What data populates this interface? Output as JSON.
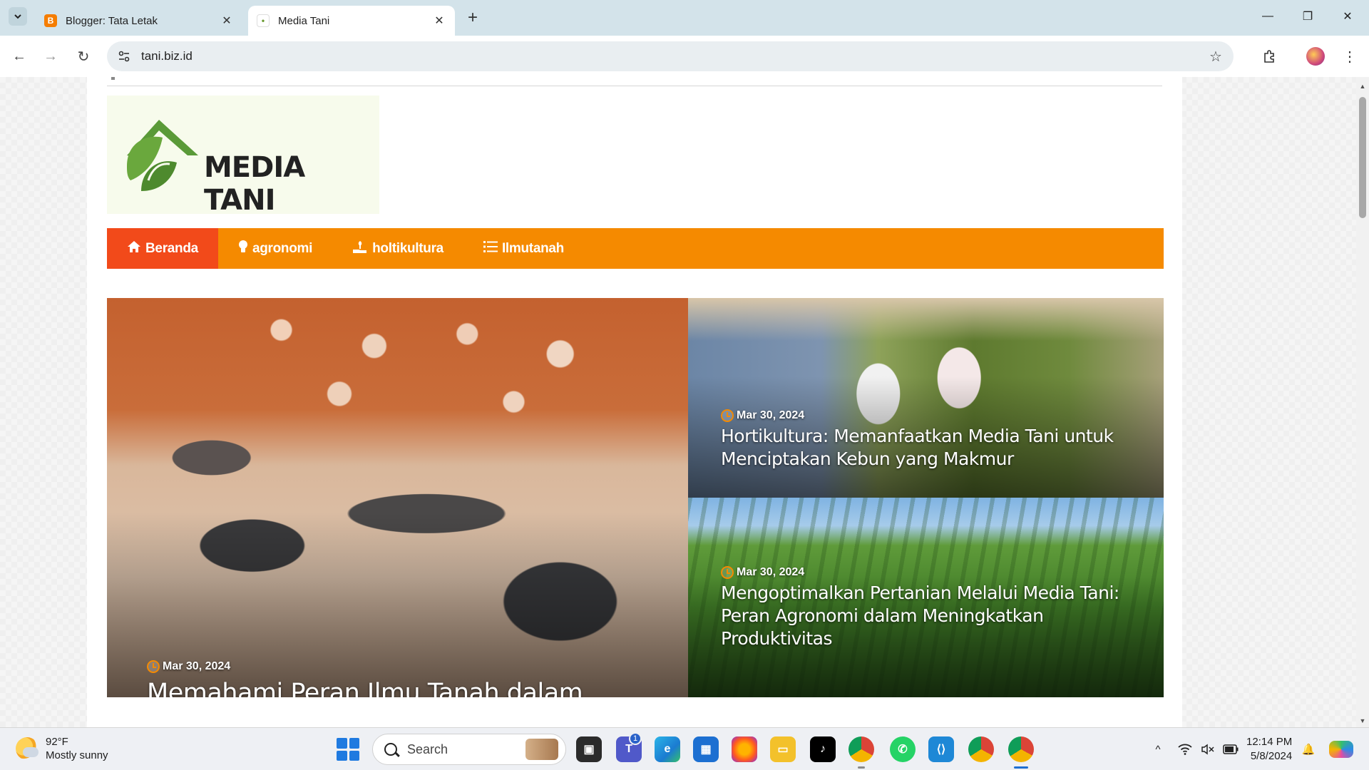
{
  "browser": {
    "tabs": [
      {
        "title": "Blogger: Tata Letak",
        "favicon": "blogger-icon"
      },
      {
        "title": "Media Tani",
        "favicon": "media-tani-favicon"
      }
    ],
    "url": "tani.biz.id"
  },
  "site": {
    "logo_text": "MEDIA TANI",
    "nav": [
      {
        "label": "Beranda",
        "icon": "home-icon"
      },
      {
        "label": "agronomi",
        "icon": "bulb-icon"
      },
      {
        "label": "holtikultura",
        "icon": "hand-plant-icon"
      },
      {
        "label": "Ilmutanah",
        "icon": "list-icon"
      }
    ],
    "colors": {
      "nav_bg": "#f58a00",
      "nav_active": "#f24a1a"
    }
  },
  "featured": {
    "main": {
      "date": "Mar 30, 2024",
      "title": "Memahami Peran Ilmu Tanah dalam Pertanian: Fondasi Media Tani"
    },
    "top_right": {
      "date": "Mar 30, 2024",
      "title": "Hortikultura: Memanfaatkan Media Tani untuk Menciptakan Kebun yang Makmur"
    },
    "bottom_right": {
      "date": "Mar 30, 2024",
      "title": "Mengoptimalkan Pertanian Melalui Media Tani: Peran Agronomi dalam Meningkatkan Produktivitas"
    }
  },
  "taskbar": {
    "weather_temp": "92°F",
    "weather_desc": "Mostly sunny",
    "search_placeholder": "Search",
    "teams_badge": "1",
    "time": "12:14 PM",
    "date": "5/8/2024"
  }
}
